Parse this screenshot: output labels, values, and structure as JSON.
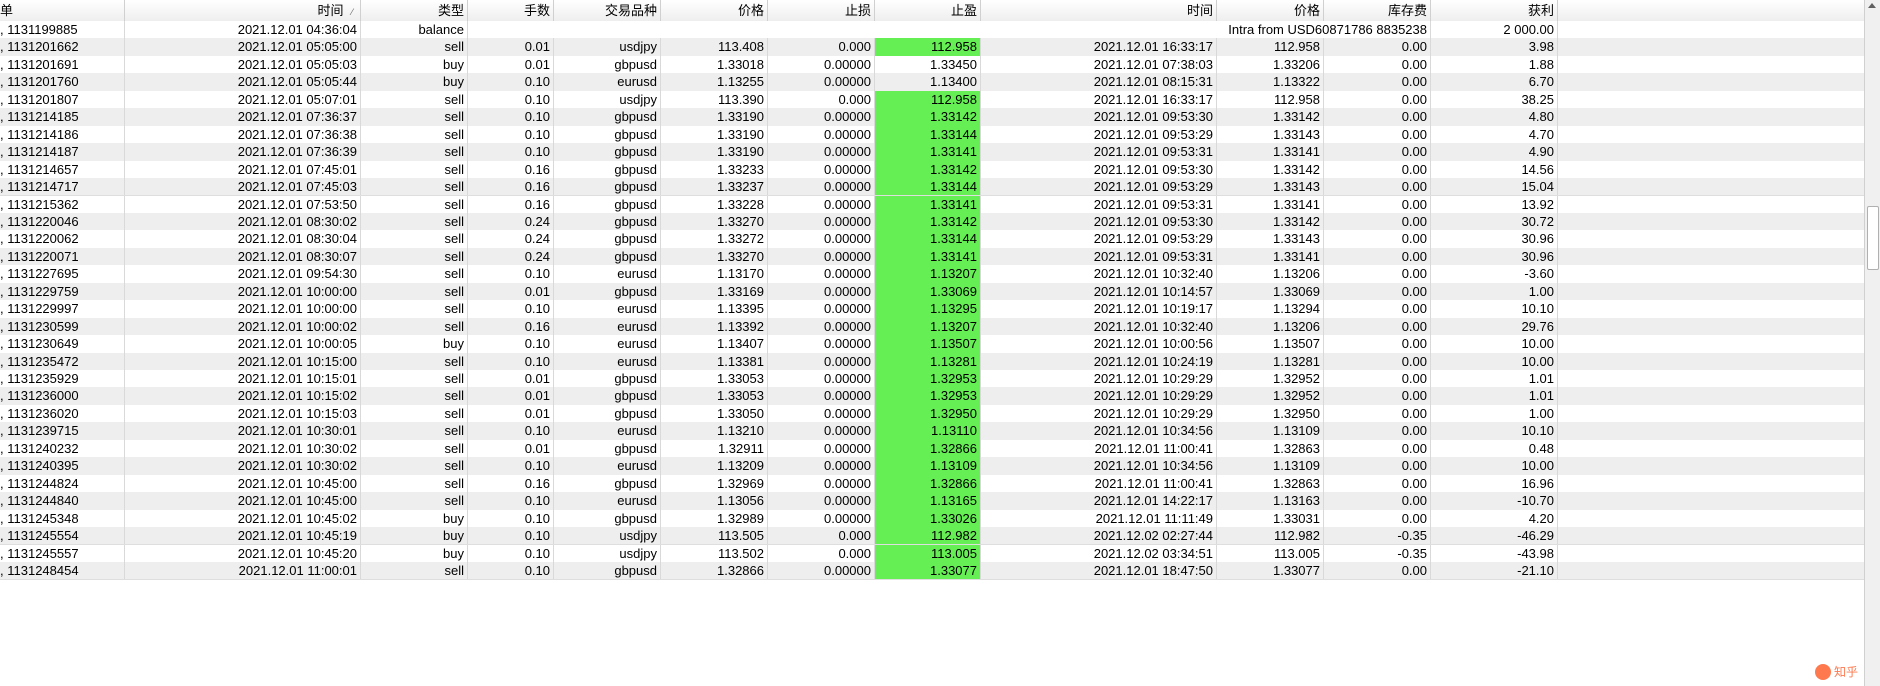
{
  "columns": [
    "单",
    "时间",
    "类型",
    "手数",
    "交易品种",
    "价格",
    "止损",
    "止盈",
    "时间",
    "价格",
    "库存费",
    "获利"
  ],
  "balance_row": {
    "ticket": "1131199885",
    "time": "2021.12.01 04:36:04",
    "type": "balance",
    "comment": "Intra from USD60871786 8835238",
    "profit": "2 000.00"
  },
  "rows": [
    [
      "1131201662",
      "2021.12.01 05:05:00",
      "sell",
      "0.01",
      "usdjpy",
      "113.408",
      "0.000",
      "112.958",
      "2021.12.01 16:33:17",
      "112.958",
      "0.00",
      "3.98",
      true
    ],
    [
      "1131201691",
      "2021.12.01 05:05:03",
      "buy",
      "0.01",
      "gbpusd",
      "1.33018",
      "0.00000",
      "1.33450",
      "2021.12.01 07:38:03",
      "1.33206",
      "0.00",
      "1.88",
      false
    ],
    [
      "1131201760",
      "2021.12.01 05:05:44",
      "buy",
      "0.10",
      "eurusd",
      "1.13255",
      "0.00000",
      "1.13400",
      "2021.12.01 08:15:31",
      "1.13322",
      "0.00",
      "6.70",
      false
    ],
    [
      "1131201807",
      "2021.12.01 05:07:01",
      "sell",
      "0.10",
      "usdjpy",
      "113.390",
      "0.000",
      "112.958",
      "2021.12.01 16:33:17",
      "112.958",
      "0.00",
      "38.25",
      true
    ],
    [
      "1131214185",
      "2021.12.01 07:36:37",
      "sell",
      "0.10",
      "gbpusd",
      "1.33190",
      "0.00000",
      "1.33142",
      "2021.12.01 09:53:30",
      "1.33142",
      "0.00",
      "4.80",
      true
    ],
    [
      "1131214186",
      "2021.12.01 07:36:38",
      "sell",
      "0.10",
      "gbpusd",
      "1.33190",
      "0.00000",
      "1.33144",
      "2021.12.01 09:53:29",
      "1.33143",
      "0.00",
      "4.70",
      true
    ],
    [
      "1131214187",
      "2021.12.01 07:36:39",
      "sell",
      "0.10",
      "gbpusd",
      "1.33190",
      "0.00000",
      "1.33141",
      "2021.12.01 09:53:31",
      "1.33141",
      "0.00",
      "4.90",
      true
    ],
    [
      "1131214657",
      "2021.12.01 07:45:01",
      "sell",
      "0.16",
      "gbpusd",
      "1.33233",
      "0.00000",
      "1.33142",
      "2021.12.01 09:53:30",
      "1.33142",
      "0.00",
      "14.56",
      true
    ],
    [
      "1131214717",
      "2021.12.01 07:45:03",
      "sell",
      "0.16",
      "gbpusd",
      "1.33237",
      "0.00000",
      "1.33144",
      "2021.12.01 09:53:29",
      "1.33143",
      "0.00",
      "15.04",
      true
    ],
    [
      "1131215362",
      "2021.12.01 07:53:50",
      "sell",
      "0.16",
      "gbpusd",
      "1.33228",
      "0.00000",
      "1.33141",
      "2021.12.01 09:53:31",
      "1.33141",
      "0.00",
      "13.92",
      true
    ],
    [
      "1131220046",
      "2021.12.01 08:30:02",
      "sell",
      "0.24",
      "gbpusd",
      "1.33270",
      "0.00000",
      "1.33142",
      "2021.12.01 09:53:30",
      "1.33142",
      "0.00",
      "30.72",
      true
    ],
    [
      "1131220062",
      "2021.12.01 08:30:04",
      "sell",
      "0.24",
      "gbpusd",
      "1.33272",
      "0.00000",
      "1.33144",
      "2021.12.01 09:53:29",
      "1.33143",
      "0.00",
      "30.96",
      true
    ],
    [
      "1131220071",
      "2021.12.01 08:30:07",
      "sell",
      "0.24",
      "gbpusd",
      "1.33270",
      "0.00000",
      "1.33141",
      "2021.12.01 09:53:31",
      "1.33141",
      "0.00",
      "30.96",
      true
    ],
    [
      "1131227695",
      "2021.12.01 09:54:30",
      "sell",
      "0.10",
      "eurusd",
      "1.13170",
      "0.00000",
      "1.13207",
      "2021.12.01 10:32:40",
      "1.13206",
      "0.00",
      "-3.60",
      true
    ],
    [
      "1131229759",
      "2021.12.01 10:00:00",
      "sell",
      "0.01",
      "gbpusd",
      "1.33169",
      "0.00000",
      "1.33069",
      "2021.12.01 10:14:57",
      "1.33069",
      "0.00",
      "1.00",
      true
    ],
    [
      "1131229997",
      "2021.12.01 10:00:00",
      "sell",
      "0.10",
      "eurusd",
      "1.13395",
      "0.00000",
      "1.13295",
      "2021.12.01 10:19:17",
      "1.13294",
      "0.00",
      "10.10",
      true
    ],
    [
      "1131230599",
      "2021.12.01 10:00:02",
      "sell",
      "0.16",
      "eurusd",
      "1.13392",
      "0.00000",
      "1.13207",
      "2021.12.01 10:32:40",
      "1.13206",
      "0.00",
      "29.76",
      true
    ],
    [
      "1131230649",
      "2021.12.01 10:00:05",
      "buy",
      "0.10",
      "eurusd",
      "1.13407",
      "0.00000",
      "1.13507",
      "2021.12.01 10:00:56",
      "1.13507",
      "0.00",
      "10.00",
      true
    ],
    [
      "1131235472",
      "2021.12.01 10:15:00",
      "sell",
      "0.10",
      "eurusd",
      "1.13381",
      "0.00000",
      "1.13281",
      "2021.12.01 10:24:19",
      "1.13281",
      "0.00",
      "10.00",
      true
    ],
    [
      "1131235929",
      "2021.12.01 10:15:01",
      "sell",
      "0.01",
      "gbpusd",
      "1.33053",
      "0.00000",
      "1.32953",
      "2021.12.01 10:29:29",
      "1.32952",
      "0.00",
      "1.01",
      true
    ],
    [
      "1131236000",
      "2021.12.01 10:15:02",
      "sell",
      "0.01",
      "gbpusd",
      "1.33053",
      "0.00000",
      "1.32953",
      "2021.12.01 10:29:29",
      "1.32952",
      "0.00",
      "1.01",
      true
    ],
    [
      "1131236020",
      "2021.12.01 10:15:03",
      "sell",
      "0.01",
      "gbpusd",
      "1.33050",
      "0.00000",
      "1.32950",
      "2021.12.01 10:29:29",
      "1.32950",
      "0.00",
      "1.00",
      true
    ],
    [
      "1131239715",
      "2021.12.01 10:30:01",
      "sell",
      "0.10",
      "eurusd",
      "1.13210",
      "0.00000",
      "1.13110",
      "2021.12.01 10:34:56",
      "1.13109",
      "0.00",
      "10.10",
      true
    ],
    [
      "1131240232",
      "2021.12.01 10:30:02",
      "sell",
      "0.01",
      "gbpusd",
      "1.32911",
      "0.00000",
      "1.32866",
      "2021.12.01 11:00:41",
      "1.32863",
      "0.00",
      "0.48",
      true
    ],
    [
      "1131240395",
      "2021.12.01 10:30:02",
      "sell",
      "0.10",
      "eurusd",
      "1.13209",
      "0.00000",
      "1.13109",
      "2021.12.01 10:34:56",
      "1.13109",
      "0.00",
      "10.00",
      true
    ],
    [
      "1131244824",
      "2021.12.01 10:45:00",
      "sell",
      "0.16",
      "gbpusd",
      "1.32969",
      "0.00000",
      "1.32866",
      "2021.12.01 11:00:41",
      "1.32863",
      "0.00",
      "16.96",
      true
    ],
    [
      "1131244840",
      "2021.12.01 10:45:00",
      "sell",
      "0.10",
      "eurusd",
      "1.13056",
      "0.00000",
      "1.13165",
      "2021.12.01 14:22:17",
      "1.13163",
      "0.00",
      "-10.70",
      true
    ],
    [
      "1131245348",
      "2021.12.01 10:45:02",
      "buy",
      "0.10",
      "gbpusd",
      "1.32989",
      "0.00000",
      "1.33026",
      "2021.12.01 11:11:49",
      "1.33031",
      "0.00",
      "4.20",
      true
    ],
    [
      "1131245554",
      "2021.12.01 10:45:19",
      "buy",
      "0.10",
      "usdjpy",
      "113.505",
      "0.000",
      "112.982",
      "2021.12.02 02:27:44",
      "112.982",
      "-0.35",
      "-46.29",
      true
    ],
    [
      "1131245557",
      "2021.12.01 10:45:20",
      "buy",
      "0.10",
      "usdjpy",
      "113.502",
      "0.000",
      "113.005",
      "2021.12.02 03:34:51",
      "113.005",
      "-0.35",
      "-43.98",
      true
    ],
    [
      "1131248454",
      "2021.12.01 11:00:01",
      "sell",
      "0.10",
      "gbpusd",
      "1.32866",
      "0.00000",
      "1.33077",
      "2021.12.01 18:47:50",
      "1.33077",
      "0.00",
      "-21.10",
      true
    ]
  ],
  "watermark": "知乎",
  "colors": {
    "tp_highlight": "#66ee55",
    "row_alt": "#eeeeee"
  }
}
